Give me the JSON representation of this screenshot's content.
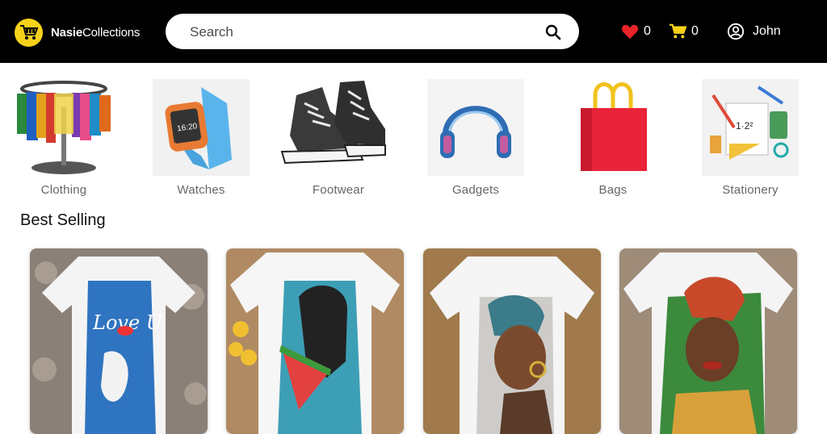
{
  "brand": {
    "name_bold": "Nasie",
    "name_light": "Collections"
  },
  "search": {
    "placeholder": "Search"
  },
  "nav": {
    "favorites_count": "0",
    "cart_count": "0",
    "user_name": "John"
  },
  "categories": [
    {
      "label": "Clothing"
    },
    {
      "label": "Watches"
    },
    {
      "label": "Footwear"
    },
    {
      "label": "Gadgets"
    },
    {
      "label": "Bags"
    },
    {
      "label": "Stationery"
    }
  ],
  "section": {
    "best_selling": "Best Selling"
  },
  "products": [
    {
      "print_text": "Love U"
    },
    {
      "print_text": ""
    },
    {
      "print_text": ""
    },
    {
      "print_text": ""
    }
  ],
  "colors": {
    "header": "#000000",
    "logo": "#f7d21b",
    "heart": "#e8232a",
    "cart": "#f7d21b"
  }
}
